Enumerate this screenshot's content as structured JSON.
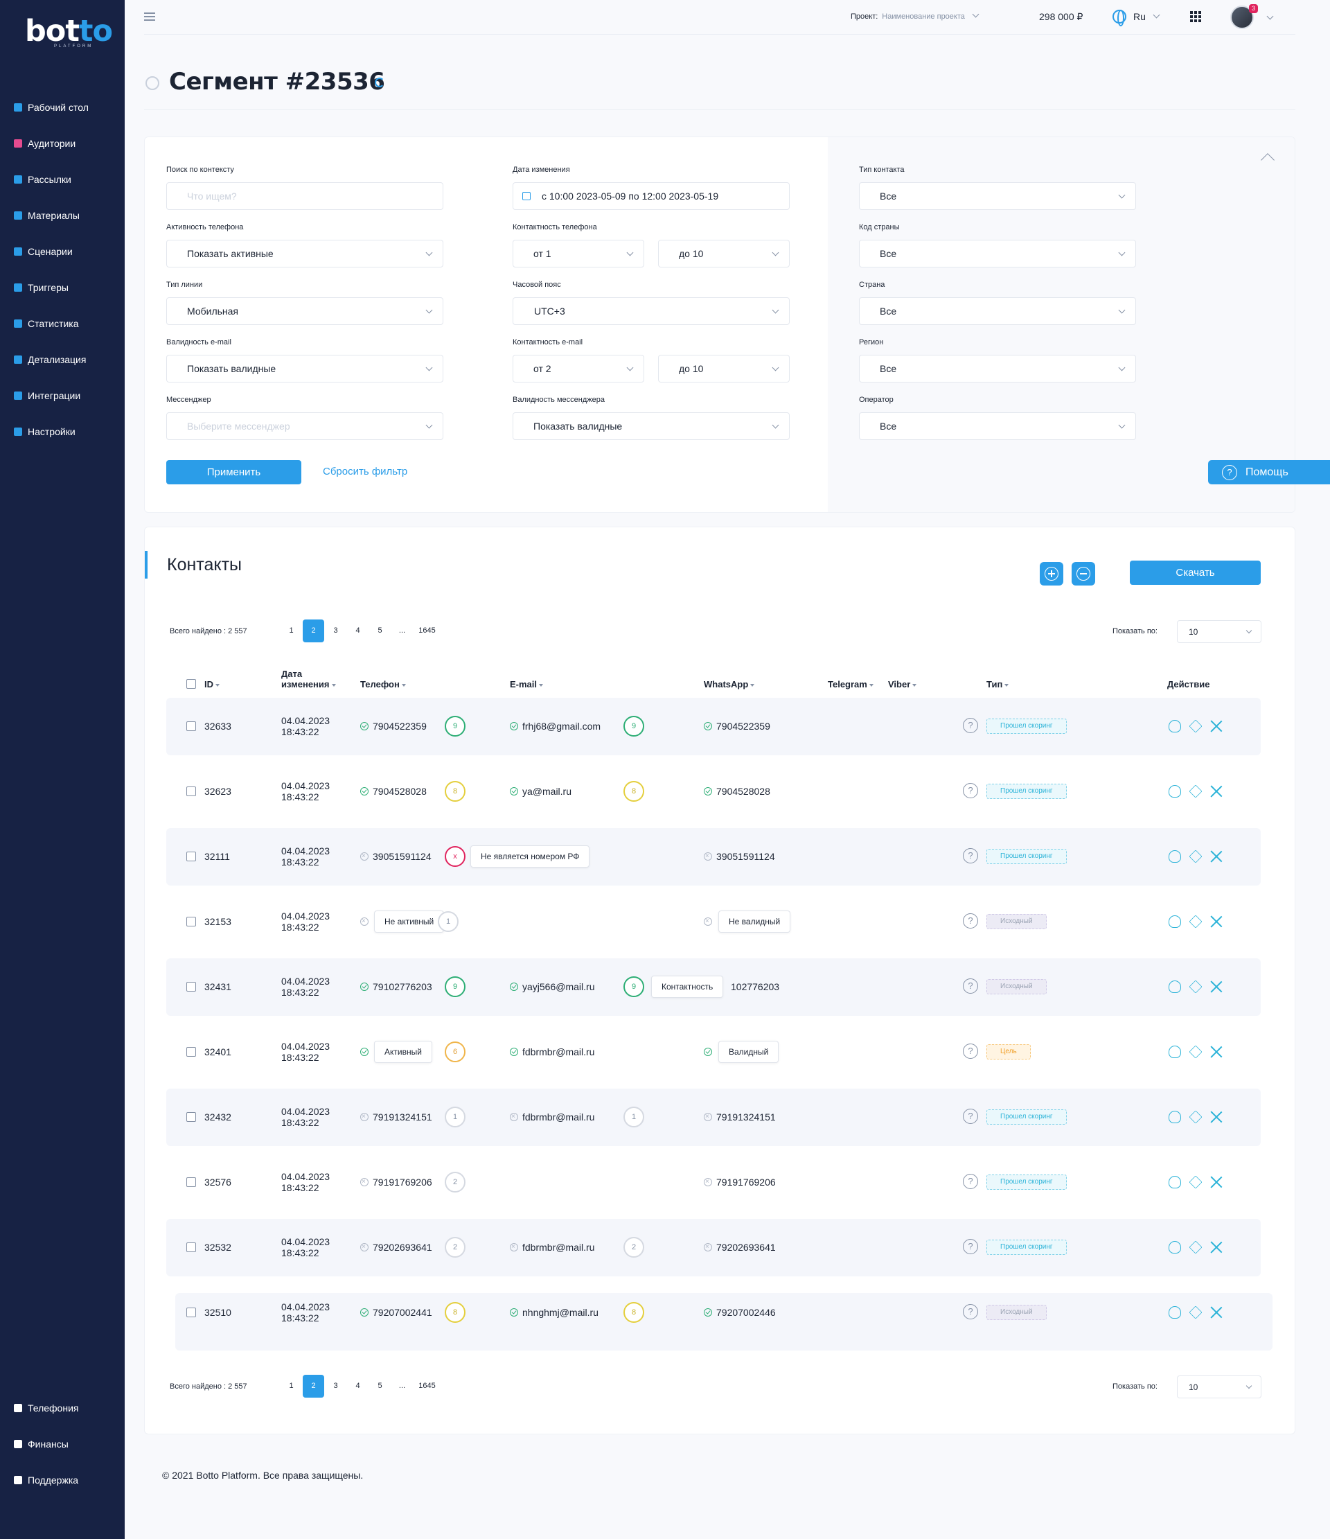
{
  "sidebar": {
    "logo_main": "bot",
    "logo_accent": "to",
    "logo_sub": "PLATFORM",
    "items": [
      {
        "label": "Рабочий стол",
        "icon": "dashboard-icon"
      },
      {
        "label": "Аудитории",
        "icon": "audience-icon"
      },
      {
        "label": "Рассылки",
        "icon": "mailing-icon"
      },
      {
        "label": "Материалы",
        "icon": "materials-icon"
      },
      {
        "label": "Сценарии",
        "icon": "scenarios-icon"
      },
      {
        "label": "Триггеры",
        "icon": "lightning-icon"
      },
      {
        "label": "Статистика",
        "icon": "stats-icon"
      },
      {
        "label": "Детализация",
        "icon": "details-icon"
      },
      {
        "label": "Интеграции",
        "icon": "integrations-icon"
      },
      {
        "label": "Настройки",
        "icon": "gear-icon"
      }
    ],
    "bottom_items": [
      {
        "label": "Телефония",
        "icon": "phone-icon"
      },
      {
        "label": "Финансы",
        "icon": "finance-icon"
      },
      {
        "label": "Поддержка",
        "icon": "support-icon"
      }
    ]
  },
  "topbar": {
    "project_label": "Проект:",
    "project_value": "Наименование проекта",
    "balance": "298 000 ₽",
    "language": "Ru",
    "notifications": "3"
  },
  "page": {
    "title": "Сегмент #23536"
  },
  "filters": {
    "search_label": "Поиск по контексту",
    "search_placeholder": "Что ищем?",
    "phone_activity_label": "Активность телефона",
    "phone_activity_value": "Показать активные",
    "line_type_label": "Тип линии",
    "line_type_value": "Мобильная",
    "email_validity_label": "Валидность e-mail",
    "email_validity_value": "Показать валидные",
    "messenger_label": "Мессенджер",
    "messenger_placeholder": "Выберите мессенджер",
    "date_label": "Дата изменения",
    "date_value": "с 10:00 2023-05-09 по 12:00 2023-05-19",
    "phone_contact_label": "Контактность телефона",
    "phone_contact_from": "от 1",
    "phone_contact_to": "до 10",
    "timezone_label": "Часовой пояс",
    "timezone_value": "UTC+3",
    "email_contact_label": "Контактность e-mail",
    "email_contact_from": "от 2",
    "email_contact_to": "до 10",
    "messenger_validity_label": "Валидность мессенджера",
    "messenger_validity_value": "Показать валидные",
    "contact_type_label": "Тип контакта",
    "contact_type_value": "Все",
    "country_code_label": "Код страны",
    "country_code_value": "Все",
    "country_label": "Страна",
    "country_value": "Все",
    "region_label": "Регион",
    "region_value": "Все",
    "operator_label": "Оператор",
    "operator_value": "Все",
    "apply_label": "Применить",
    "reset_label": "Сбросить фильтр"
  },
  "help_label": "Помощь",
  "contacts": {
    "title": "Контакты",
    "download_label": "Скачать",
    "total_text": "Всего найдено : 2 557",
    "pages": [
      "1",
      "2",
      "3",
      "4",
      "5",
      "...",
      "1645"
    ],
    "active_page": "2",
    "show_by_label": "Показать по:",
    "show_by_value": "10",
    "columns": {
      "id": "ID",
      "date": "Дата изменения",
      "phone": "Телефон",
      "email": "E-mail",
      "whatsapp": "WhatsApp",
      "telegram": "Telegram",
      "viber": "Viber",
      "type": "Тип",
      "action": "Действие"
    },
    "rows": [
      {
        "id": "32633",
        "date": "04.04.2023",
        "time": "18:43:22",
        "phone": "7904522359",
        "phone_ok": true,
        "phone_score": "9",
        "phone_color": "g",
        "email": "frhj68@gmail.com",
        "email_ok": true,
        "email_score": "9",
        "email_color": "g",
        "whatsapp": "7904522359",
        "wa_ok": true,
        "type": "Прошел скоринг",
        "type_color": "blue"
      },
      {
        "id": "32623",
        "date": "04.04.2023",
        "time": "18:43:22",
        "phone": "7904528028",
        "phone_ok": true,
        "phone_score": "8",
        "phone_color": "y",
        "email": "ya@mail.ru",
        "email_ok": true,
        "email_score": "8",
        "email_color": "y",
        "whatsapp": "7904528028",
        "wa_ok": true,
        "type": "Прошел скоринг",
        "type_color": "blue"
      },
      {
        "id": "32111",
        "date": "04.04.2023",
        "time": "18:43:22",
        "phone": "39051591124",
        "phone_ok": false,
        "phone_score": "x",
        "phone_color": "r",
        "phone_tip": "Не является номером РФ",
        "whatsapp": "39051591124",
        "wa_ok": false,
        "type": "Прошел скоринг",
        "type_color": "blue"
      },
      {
        "id": "32153",
        "date": "04.04.2023",
        "time": "18:43:22",
        "phone_ok": false,
        "phone_score": "1",
        "phone_color": "gr",
        "phone_tip": "Не активный",
        "wa_ok": false,
        "wa_tip": "Не валидный",
        "type": "Исходный",
        "type_color": "gray"
      },
      {
        "id": "32431",
        "date": "04.04.2023",
        "time": "18:43:22",
        "phone": "79102776203",
        "phone_ok": true,
        "phone_score": "9",
        "phone_color": "g",
        "email": "yayj566@mail.ru",
        "email_ok": true,
        "email_score": "9",
        "email_color": "g",
        "email_tip": "Контактность",
        "whatsapp": "102776203",
        "type": "Исходный",
        "type_color": "gray"
      },
      {
        "id": "32401",
        "date": "04.04.2023",
        "time": "18:43:22",
        "phone_ok": true,
        "phone_score": "6",
        "phone_color": "o",
        "phone_tip": "Активный",
        "email": "fdbrmbr@mail.ru",
        "email_ok": true,
        "wa_ok": true,
        "wa_tip": "Валидный",
        "type": "Цель",
        "type_color": "orange"
      },
      {
        "id": "32432",
        "date": "04.04.2023",
        "time": "18:43:22",
        "phone": "79191324151",
        "phone_ok": false,
        "phone_score": "1",
        "phone_color": "gr",
        "email": "fdbrmbr@mail.ru",
        "email_ok": false,
        "email_score": "1",
        "email_color": "gr",
        "whatsapp": "79191324151",
        "wa_ok": false,
        "type": "Прошел скоринг",
        "type_color": "blue"
      },
      {
        "id": "32576",
        "date": "04.04.2023",
        "time": "18:43:22",
        "phone": "79191769206",
        "phone_ok": false,
        "phone_score": "2",
        "phone_color": "gr",
        "whatsapp": "79191769206",
        "wa_ok": false,
        "type": "Прошел скоринг",
        "type_color": "blue"
      },
      {
        "id": "32532",
        "date": "04.04.2023",
        "time": "18:43:22",
        "phone": "79202693641",
        "phone_ok": false,
        "phone_score": "2",
        "phone_color": "gr",
        "email": "fdbrmbr@mail.ru",
        "email_ok": false,
        "email_score": "2",
        "email_color": "gr",
        "whatsapp": "79202693641",
        "wa_ok": false,
        "type": "Прошел скоринг",
        "type_color": "blue"
      },
      {
        "id": "32510",
        "date": "04.04.2023",
        "time": "18:43:22",
        "phone": "79207002441",
        "phone_ok": true,
        "phone_score": "8",
        "phone_color": "y",
        "email": "nhnghmj@mail.ru",
        "email_ok": true,
        "email_score": "8",
        "email_color": "y",
        "whatsapp": "79207002446",
        "wa_ok": true,
        "type": "Исходный",
        "type_color": "gray"
      }
    ]
  },
  "footer": "© 2021 Botto Platform. Все права защищены."
}
